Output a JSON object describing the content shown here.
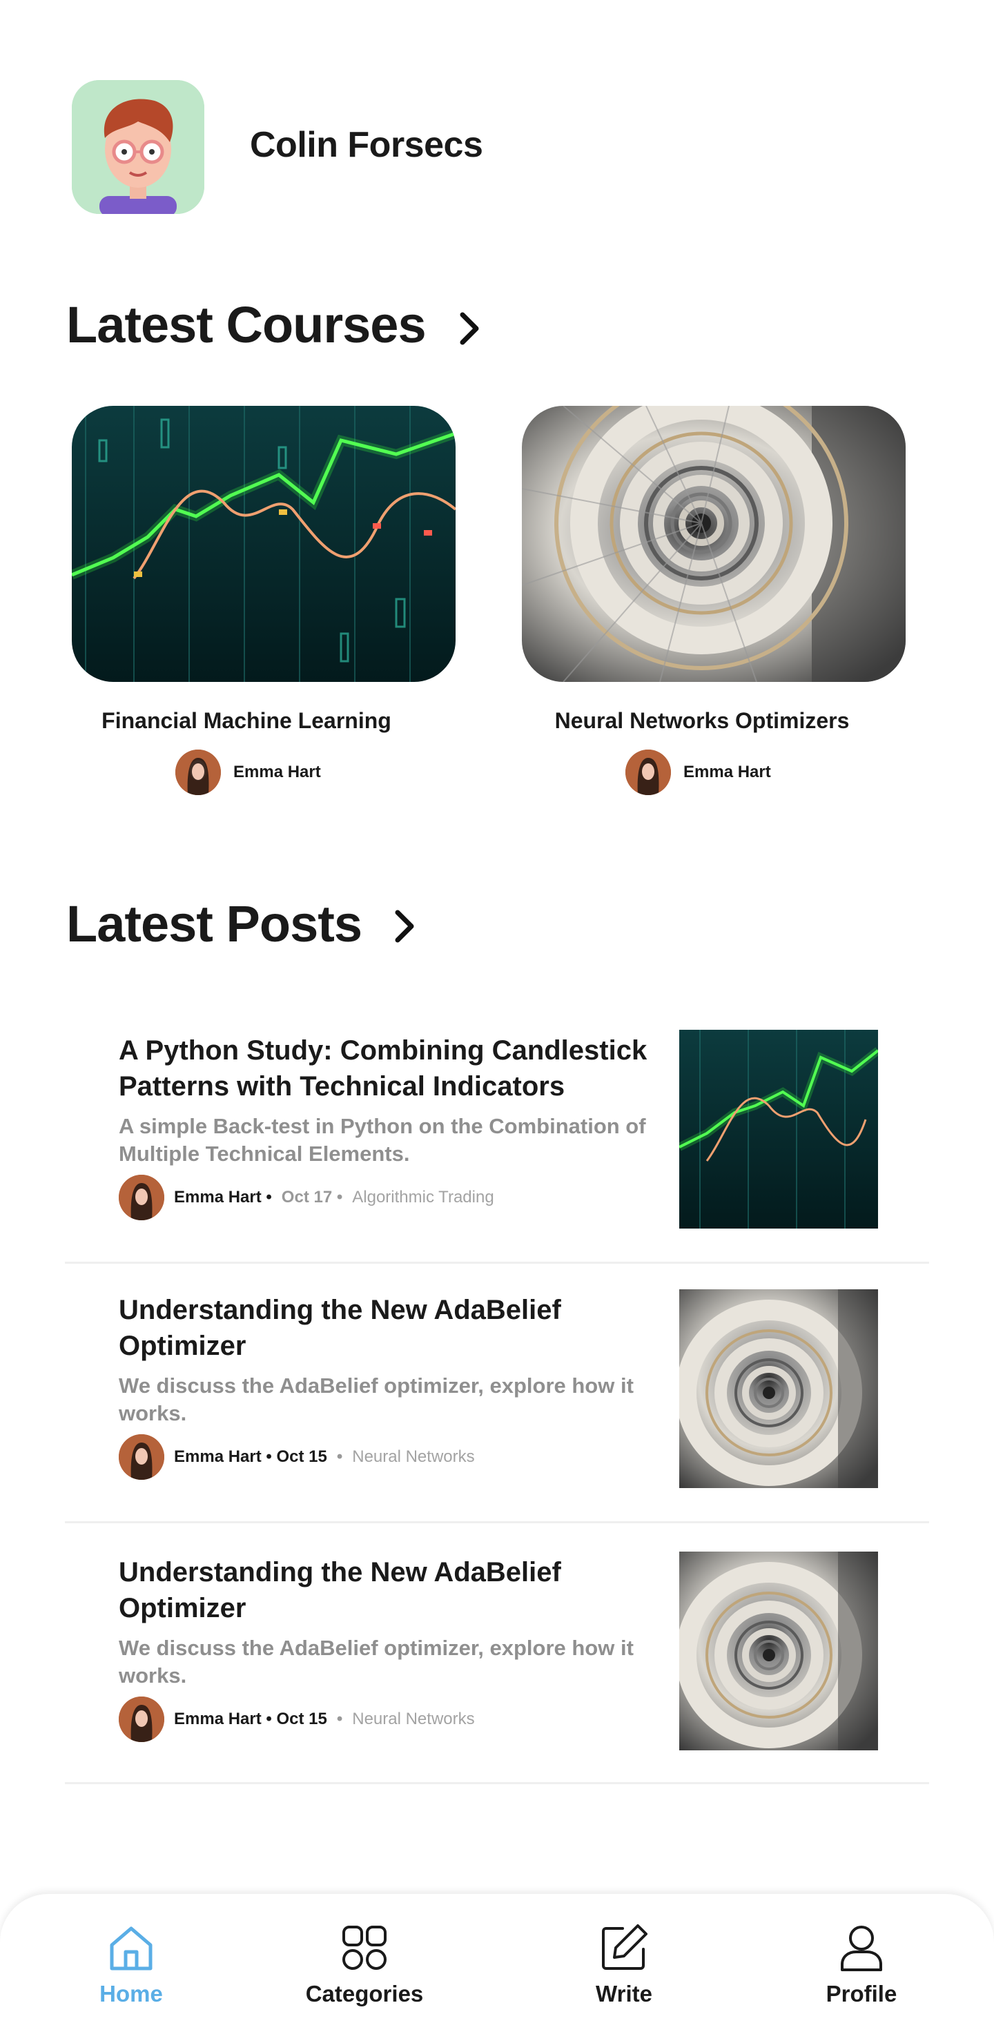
{
  "header": {
    "user_name": "Colin Forsecs"
  },
  "sections": {
    "courses_title": "Latest Courses",
    "posts_title": "Latest Posts"
  },
  "courses": [
    {
      "title": "Financial Machine Learning",
      "author": "Emma Hart"
    },
    {
      "title": "Neural Networks Optimizers",
      "author": "Emma Hart"
    }
  ],
  "posts": [
    {
      "title": "A Python Study: Combining Candlestick Patterns with Technical Indicators",
      "description": "A simple Back-test in Python on the Combination of Multiple Technical Elements.",
      "author": "Emma Hart •",
      "date": "Oct 17 •",
      "category": "Algorithmic Trading"
    },
    {
      "title": "Understanding the New AdaBelief Optimizer",
      "description": "We discuss the AdaBelief optimizer, explore how it works.",
      "author": "Emma Hart • Oct 15",
      "date": "•",
      "category": "Neural Networks"
    },
    {
      "title": "Understanding the New AdaBelief Optimizer",
      "description": "We discuss the AdaBelief optimizer, explore how it works.",
      "author": "Emma Hart • Oct 15",
      "date": "•",
      "category": "Neural Networks"
    }
  ],
  "nav": [
    {
      "label": "Home",
      "icon": "home-icon"
    },
    {
      "label": "Categories",
      "icon": "grid-icon"
    },
    {
      "label": "Write",
      "icon": "edit-icon"
    },
    {
      "label": "Profile",
      "icon": "user-icon"
    }
  ],
  "colors": {
    "accent": "#5aaee6",
    "text": "#1a1a1a",
    "muted": "#8f8f8f"
  }
}
